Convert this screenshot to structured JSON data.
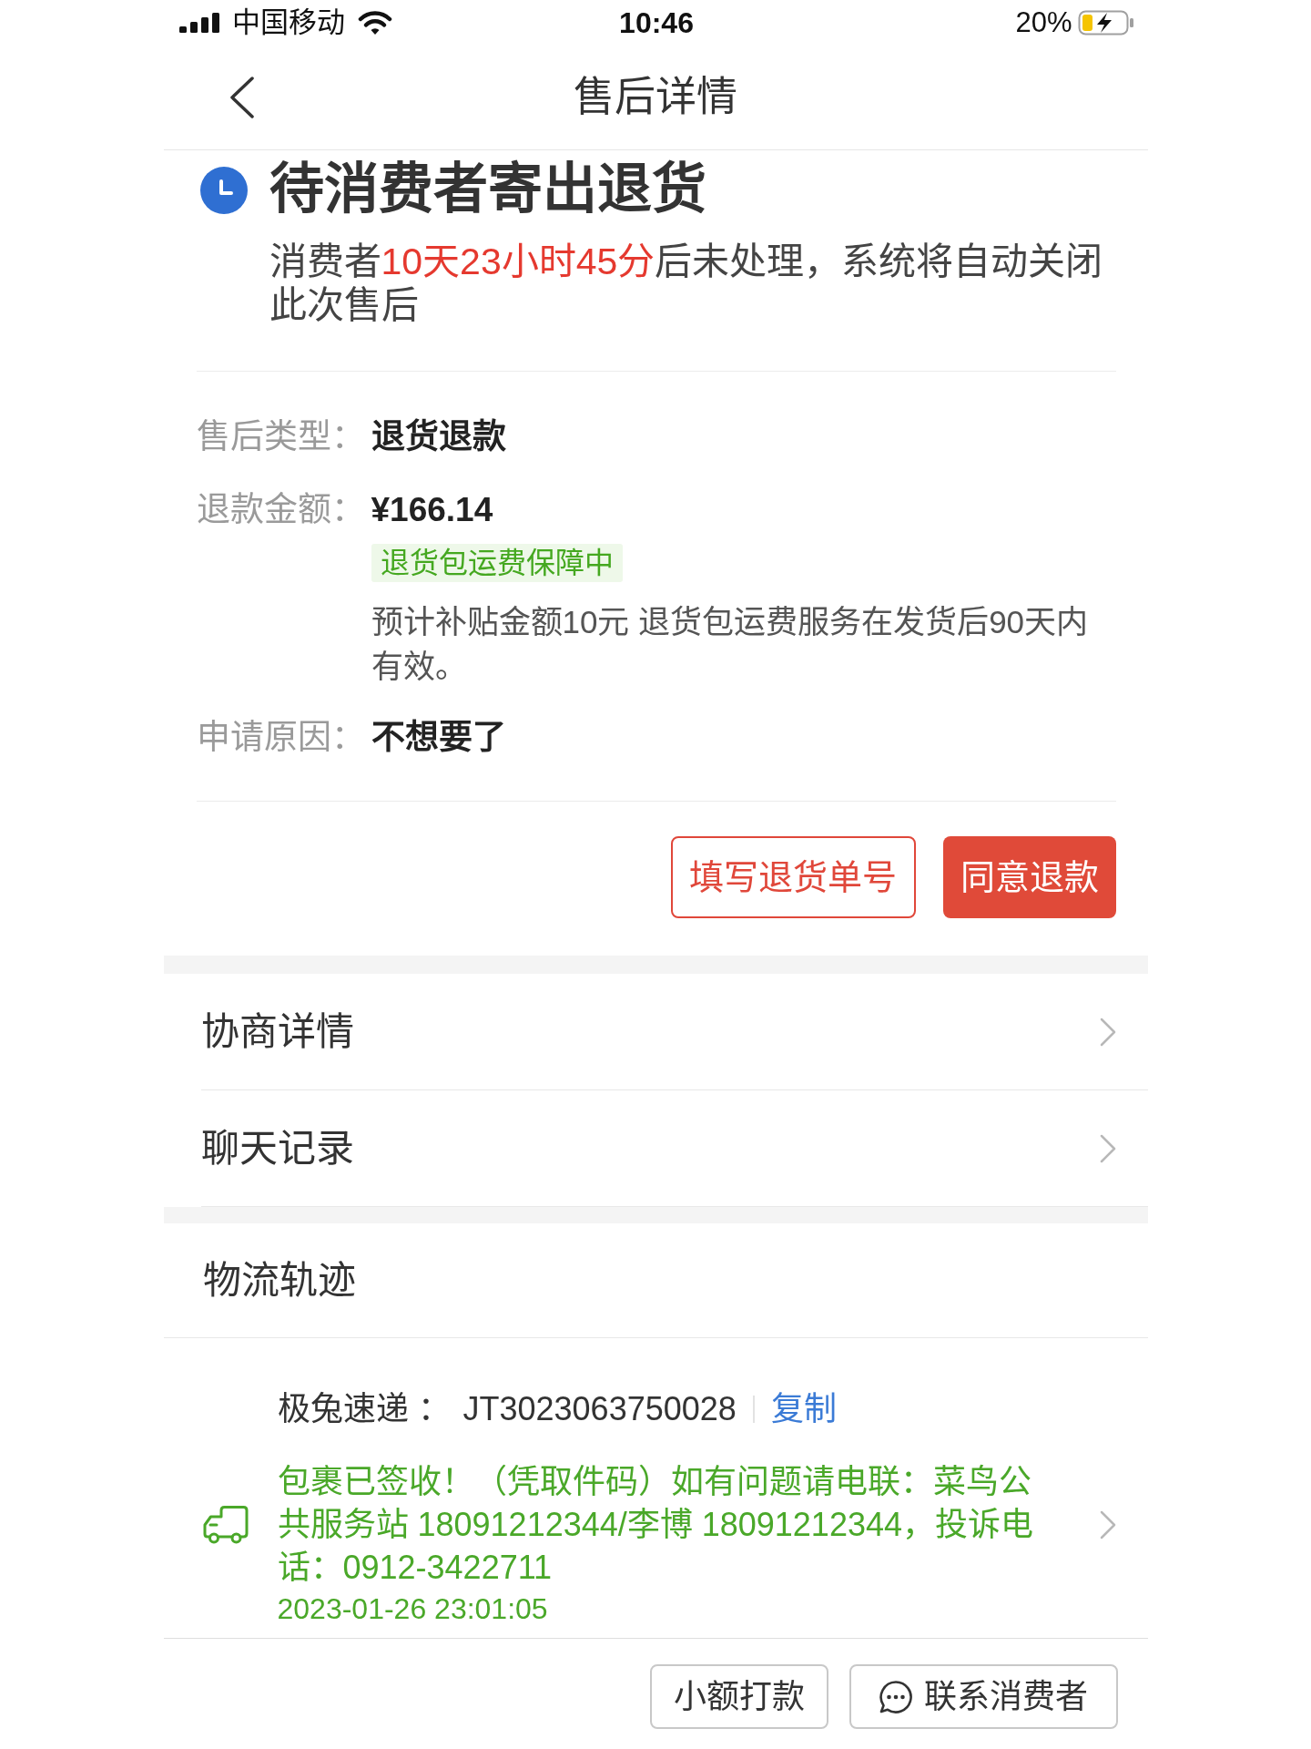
{
  "status_bar": {
    "carrier": "中国移动",
    "time": "10:46",
    "battery": "20%"
  },
  "nav_bar": {
    "title": "售后详情"
  },
  "status": {
    "title": "待消费者寄出退货",
    "message": [
      {
        "text": "消费者",
        "highlight": false
      },
      {
        "text": "10天23小时45分",
        "highlight": true
      },
      {
        "text": "后未处理，系统将自动关闭此次售后",
        "highlight": false
      }
    ]
  },
  "details": [
    {
      "label": "售后类型：",
      "value": "退货退款"
    },
    {
      "label": "退款金额：",
      "value": "¥166.14",
      "tag": "退货包运费保障中",
      "note": "预计补贴金额10元 退货包运费服务在发货后90天内有效。"
    },
    {
      "label": "申请原因：",
      "value": "不想要了"
    }
  ],
  "actions": [
    {
      "label": "填写退货单号",
      "kind": "outline"
    },
    {
      "label": "同意退款",
      "kind": "filled"
    }
  ],
  "menu": [
    {
      "label": "协商详情"
    },
    {
      "label": "聊天记录"
    }
  ],
  "logistics": {
    "title": "物流轨迹",
    "carrier": "极兔速递 ：",
    "tracking_number": "JT3023063750028",
    "copy": "复制",
    "update": "包裹已签收！（凭取件码）如有问题请电联：菜鸟公共服务站 18091212344/李博 18091212344，投诉电话：0912-3422711",
    "time": "2023-01-26 23:01:05"
  },
  "bottom_bar": [
    {
      "label": "小额打款",
      "kind": "plain"
    },
    {
      "label": "联系消费者",
      "kind": "chat"
    }
  ]
}
